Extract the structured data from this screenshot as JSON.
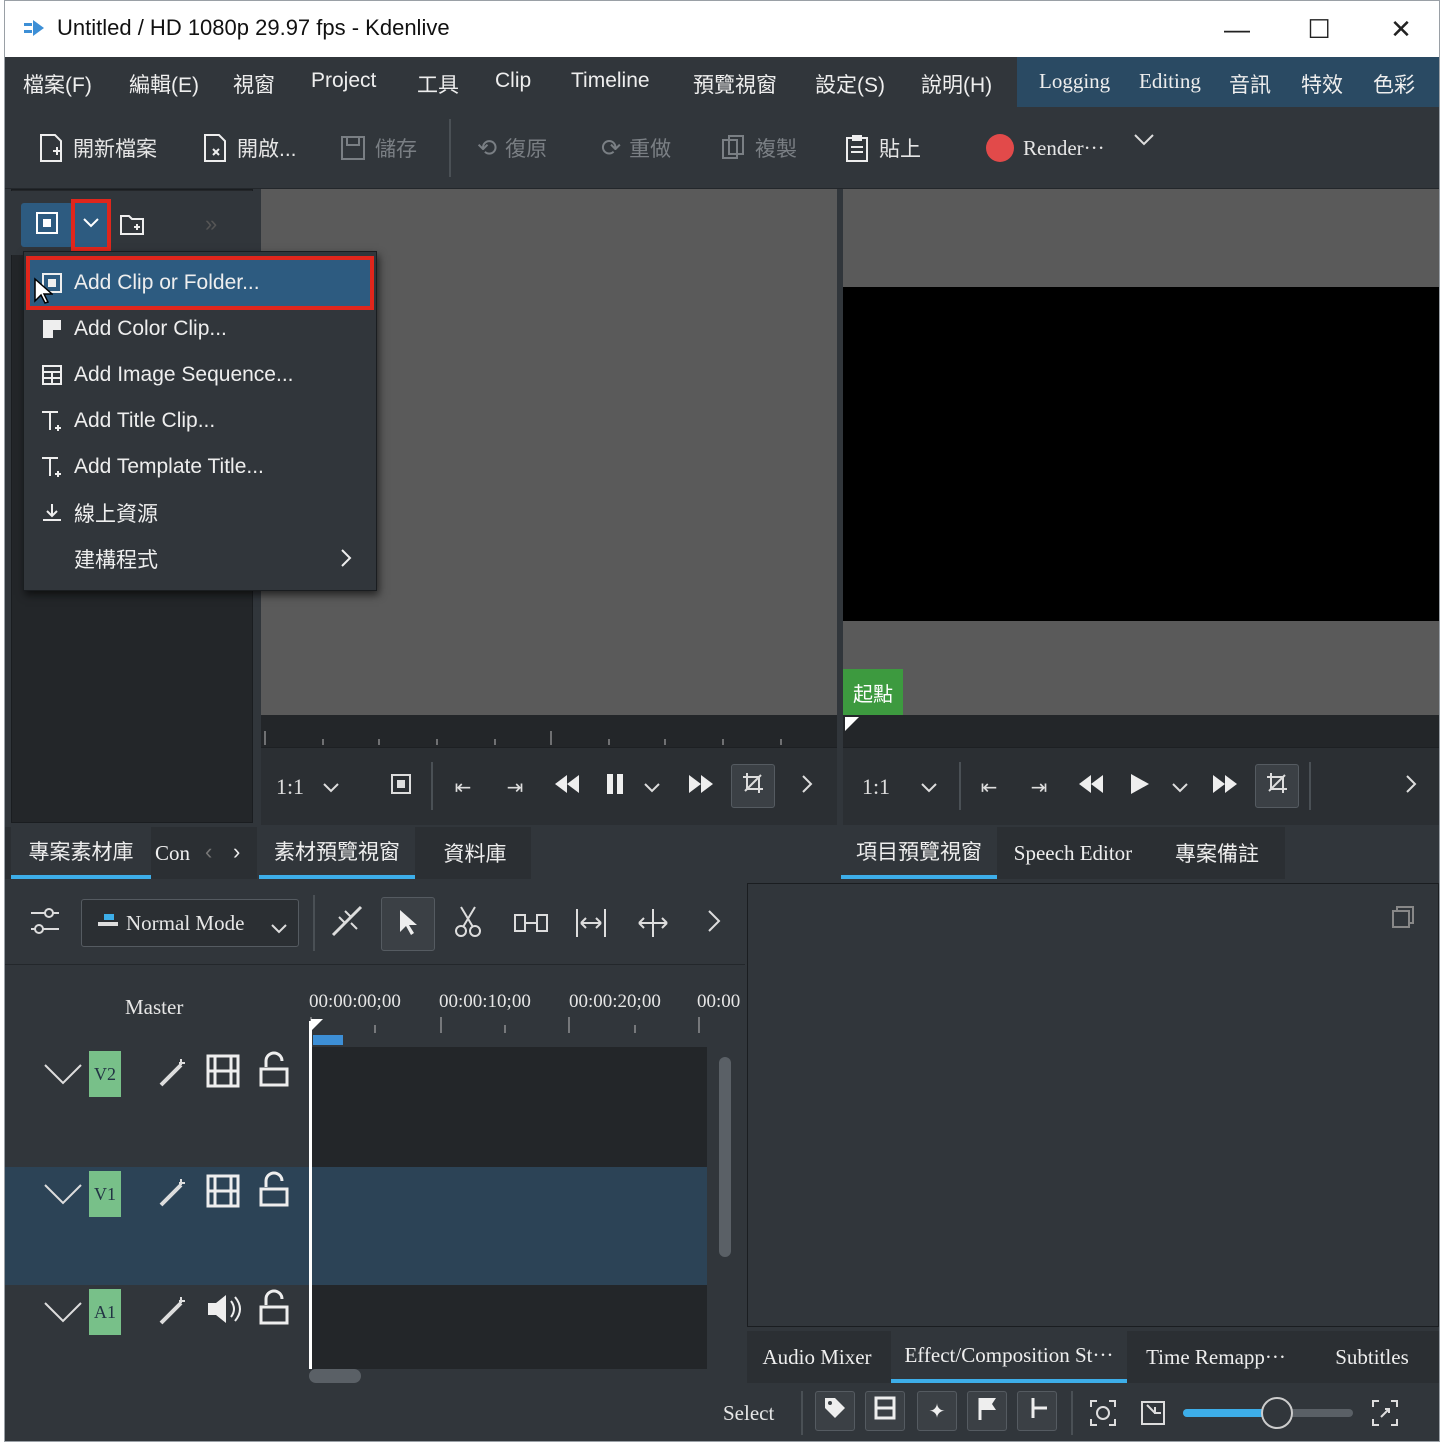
{
  "window": {
    "title": "Untitled / HD 1080p 29.97 fps - Kdenlive",
    "controls": {
      "minimize": "—",
      "maximize": "☐",
      "close": "✕"
    }
  },
  "menubar": {
    "items": [
      "檔案(F)",
      "編輯(E)",
      "視窗",
      "Project",
      "工具",
      "Clip",
      "Timeline",
      "預覽視窗",
      "設定(S)",
      "說明(H)"
    ],
    "layouts": [
      "Logging",
      "Editing",
      "音訊",
      "特效",
      "色彩"
    ]
  },
  "toolbar": {
    "new": "開新檔案",
    "open": "開啟...",
    "save": "儲存",
    "undo": "復原",
    "redo": "重做",
    "copy": "複製",
    "paste": "貼上",
    "render": "Render···"
  },
  "bin_menu": {
    "items": [
      {
        "label": "Add Clip or Folder...",
        "icon": "add-clip-icon"
      },
      {
        "label": "Add Color Clip...",
        "icon": "color-clip-icon"
      },
      {
        "label": "Add Image Sequence...",
        "icon": "image-sequence-icon"
      },
      {
        "label": "Add Title Clip...",
        "icon": "title-clip-icon"
      },
      {
        "label": "Add Template Title...",
        "icon": "template-title-icon"
      },
      {
        "label": "線上資源",
        "icon": "download-icon"
      },
      {
        "label": "建構程式",
        "icon": "submenu-arrow-icon"
      }
    ]
  },
  "clip_monitor": {
    "zoom": "1:1"
  },
  "project_monitor": {
    "zoom": "1:1",
    "in_point": "起點"
  },
  "left_tabs": [
    "專案素材庫",
    "Con"
  ],
  "center_tabs": [
    "素材預覽視窗",
    "資料庫"
  ],
  "right_tabs": [
    "項目預覽視窗",
    "Speech Editor",
    "專案備註"
  ],
  "timeline": {
    "mode": "Normal Mode",
    "master": "Master",
    "ruler": [
      "00:00:00;00",
      "00:00:10;00",
      "00:00:20;00",
      "00:00"
    ],
    "tracks": [
      {
        "name": "V2"
      },
      {
        "name": "V1"
      },
      {
        "name": "A1"
      }
    ]
  },
  "bottom_tabs": [
    "Audio Mixer",
    "Effect/Composition St···",
    "Time Remapp···",
    "Subtitles"
  ],
  "statusbar": {
    "select": "Select",
    "zoom_level": 0.55
  }
}
